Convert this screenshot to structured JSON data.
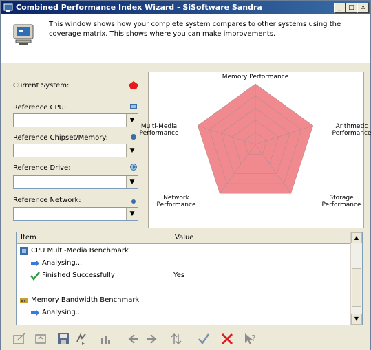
{
  "window": {
    "title": "Combined Performance Index Wizard - SiSoftware Sandra",
    "btn_minimize": "_",
    "btn_maximize": "□",
    "btn_close": "x"
  },
  "header": {
    "description": "This window shows how your complete system compares to other systems using the coverage matrix. This shows where you can make improvements."
  },
  "left_panel": {
    "current_system_label": "Current System:",
    "current_system_color": "#e8191b",
    "reference_cpu_label": "Reference CPU:",
    "reference_cpu_value": "",
    "reference_chipset_label": "Reference Chipset/Memory:",
    "reference_chipset_value": "",
    "reference_drive_label": "Reference Drive:",
    "reference_drive_value": "",
    "reference_network_label": "Reference Network:",
    "reference_network_value": "",
    "dropdown_arrow": "▼"
  },
  "radar": {
    "axes": [
      {
        "label_lines": [
          "Memory Performance"
        ]
      },
      {
        "label_lines": [
          "Arithmetic",
          "Performance"
        ]
      },
      {
        "label_lines": [
          "Storage",
          "Performance"
        ]
      },
      {
        "label_lines": [
          "Network",
          "Performance"
        ]
      },
      {
        "label_lines": [
          "Multi-Media",
          "Performance"
        ]
      }
    ],
    "fill_color": "#f08a8e",
    "fill_fraction": 1.0
  },
  "results": {
    "col_item": "Item",
    "col_value": "Value",
    "scroll_up": "▲",
    "scroll_down": "▼",
    "rows": [
      {
        "text": "CPU Multi-Media Benchmark",
        "value": "",
        "kind": "group",
        "icon": "cpu-icon"
      },
      {
        "text": "Analysing...",
        "value": "",
        "kind": "status",
        "icon": "arrow-right-icon"
      },
      {
        "text": "Finished Successfully",
        "value": "Yes",
        "kind": "status",
        "icon": "checkmark-icon"
      },
      {
        "text": "",
        "value": "",
        "kind": "blank",
        "icon": ""
      },
      {
        "text": "Memory Bandwidth Benchmark",
        "value": "",
        "kind": "group",
        "icon": "memory-icon"
      },
      {
        "text": "Analysing...",
        "value": "",
        "kind": "status",
        "icon": "arrow-right-icon"
      }
    ]
  },
  "toolbar": {
    "buttons": [
      "options-icon",
      "wizard-icon",
      "save-icon",
      "refresh-icon",
      "chart-icon",
      "back-icon",
      "forward-icon",
      "update-icon",
      "ok-icon",
      "cancel-icon",
      "help-icon"
    ]
  }
}
